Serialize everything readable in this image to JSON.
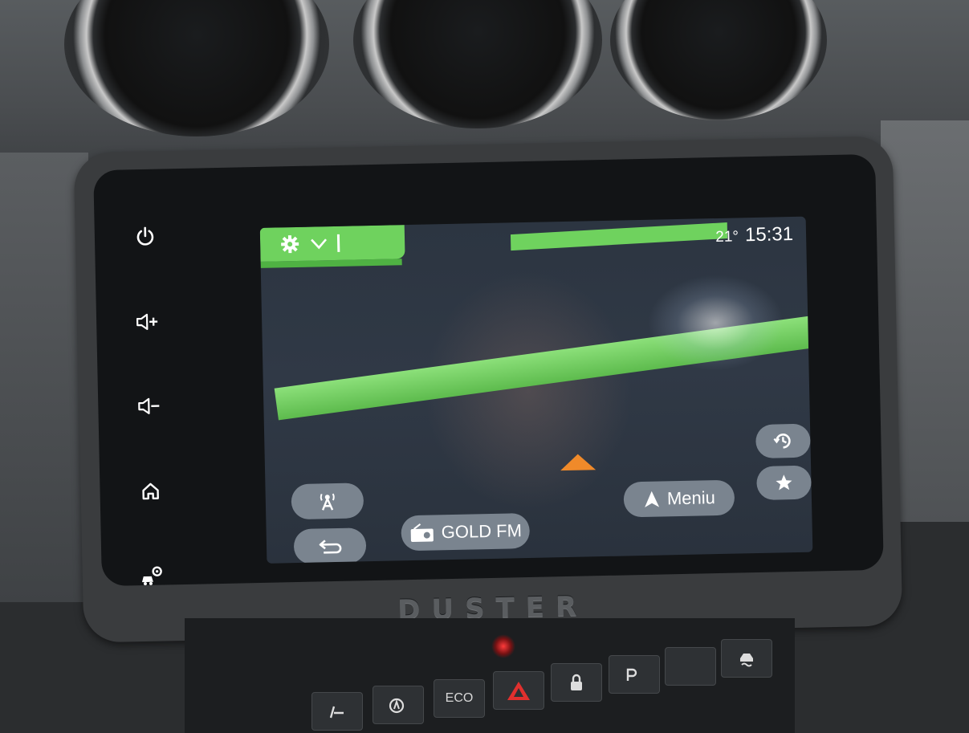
{
  "status": {
    "temperature": "21°",
    "time": "15:31"
  },
  "map": {
    "menu_label": "Meniu",
    "radio_station": "GOLD FM"
  },
  "bezel": {
    "brand": "DUSTER"
  },
  "console": {
    "eco_label": "ECO"
  },
  "colors": {
    "road_green": "#6fd25e",
    "car_arrow": "#f08a2a",
    "pill_grey": "#7a848f"
  },
  "icons": {
    "side_keys": [
      "power-icon",
      "volume-up-icon",
      "volume-down-icon",
      "home-icon",
      "car-settings-icon"
    ],
    "status_bar": [
      "gear-icon",
      "chevron-down-icon"
    ],
    "map_buttons": [
      "radio-tower-icon",
      "back-icon",
      "radio-icon",
      "navigation-arrow-icon",
      "history-icon",
      "star-icon"
    ]
  }
}
